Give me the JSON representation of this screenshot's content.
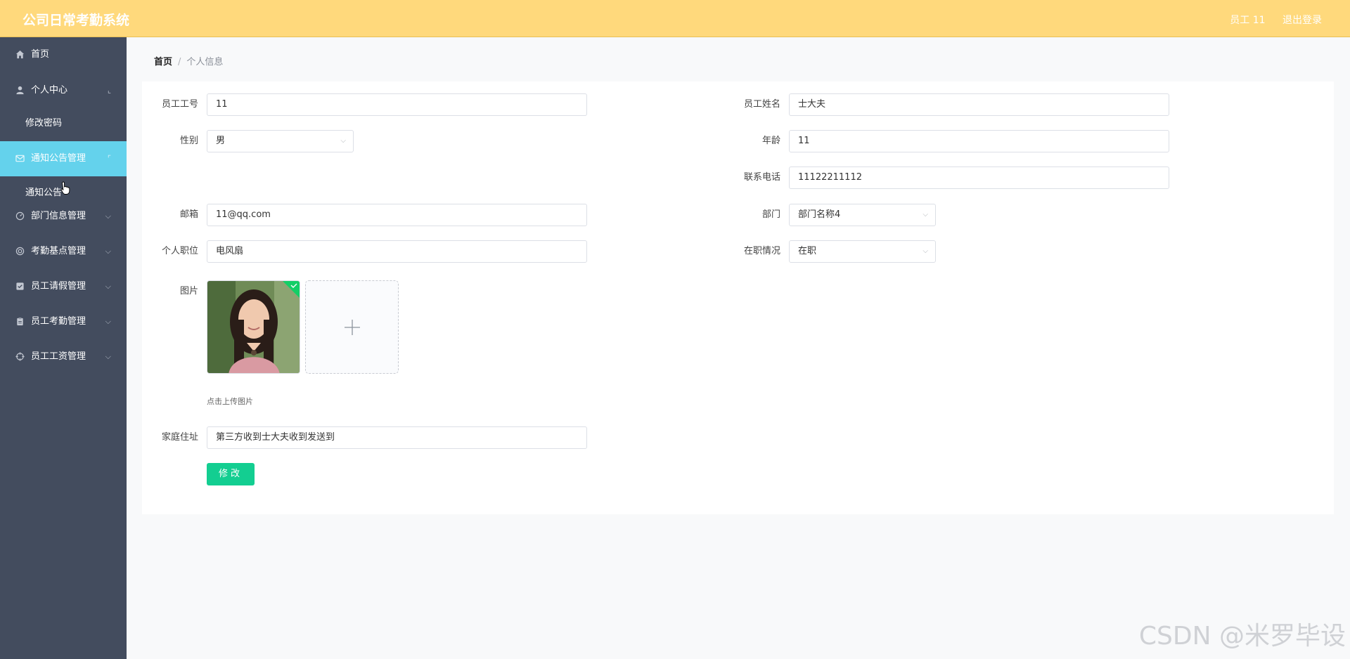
{
  "header": {
    "title": "公司日常考勤系统",
    "user_label": "员工 11",
    "logout_label": "退出登录"
  },
  "sidebar": {
    "items": [
      {
        "label": "首页",
        "icon": "home-icon"
      },
      {
        "label": "个人中心",
        "icon": "user-icon",
        "sub": [
          "修改密码"
        ]
      },
      {
        "label": "通知公告管理",
        "icon": "mail-icon",
        "sub": [
          "通知公告"
        ],
        "active": true
      },
      {
        "label": "部门信息管理",
        "icon": "gauge-icon"
      },
      {
        "label": "考勤基点管理",
        "icon": "target-icon"
      },
      {
        "label": "员工请假管理",
        "icon": "checkbox-icon"
      },
      {
        "label": "员工考勤管理",
        "icon": "clipboard-icon"
      },
      {
        "label": "员工工资管理",
        "icon": "crosshair-icon"
      }
    ]
  },
  "breadcrumb": {
    "home": "首页",
    "current": "个人信息"
  },
  "form": {
    "employee_no_label": "员工工号",
    "employee_no_value": "11",
    "employee_name_label": "员工姓名",
    "employee_name_value": "士大夫",
    "gender_label": "性别",
    "gender_value": "男",
    "age_label": "年龄",
    "age_value": "11",
    "phone_label": "联系电话",
    "phone_value": "11122211112",
    "email_label": "邮箱",
    "email_value": "11@qq.com",
    "department_label": "部门",
    "department_value": "部门名称4",
    "position_label": "个人职位",
    "position_value": "电风扇",
    "status_label": "在职情况",
    "status_value": "在职",
    "photo_label": "图片",
    "upload_hint": "点击上传图片",
    "address_label": "家庭住址",
    "address_value": "第三方收到士大夫收到发送到",
    "submit_label": "修改"
  },
  "watermark": "CSDN @米罗毕设",
  "colors": {
    "header_bg": "#ffd97c",
    "sidebar_bg": "#434c5e",
    "active_bg": "#64d2ec",
    "primary_button": "#13ce91"
  }
}
